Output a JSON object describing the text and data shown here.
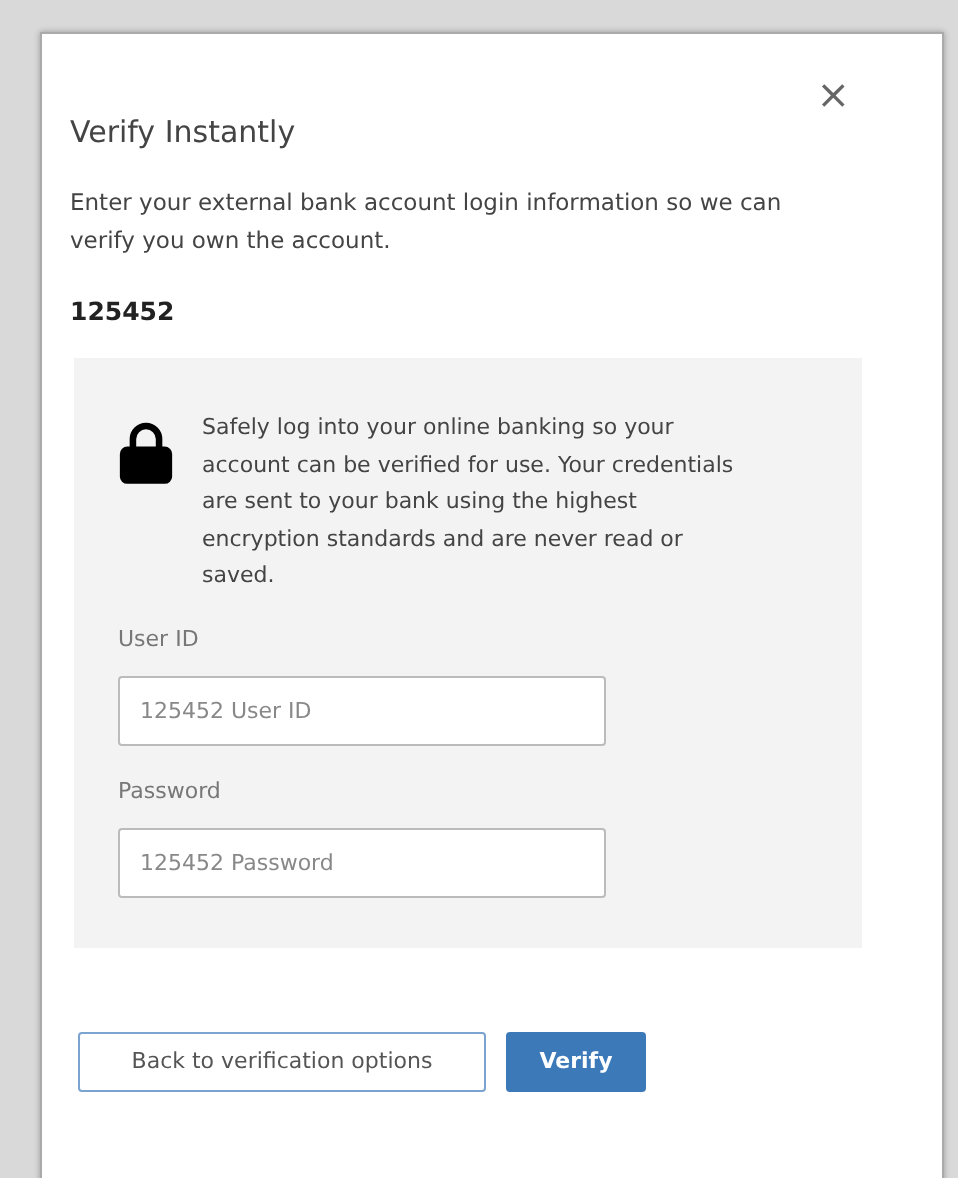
{
  "dialog": {
    "title": "Verify Instantly",
    "close": "×",
    "description": "Enter your external bank account login information so we can verify you own the account.",
    "account": "125452",
    "notice": "Safely log into your online banking so your account can be verified for use. Your credentials are sent to your bank using the highest encryption standards and are never read or saved.",
    "fields": [
      {
        "label": "User ID",
        "placeholder": "125452 User ID"
      },
      {
        "label": "Password",
        "placeholder": "125452 Password"
      }
    ],
    "buttons": [
      {
        "label": "Back to verification options",
        "kind": "secondary"
      },
      {
        "label": "Verify",
        "kind": "primary"
      }
    ]
  }
}
